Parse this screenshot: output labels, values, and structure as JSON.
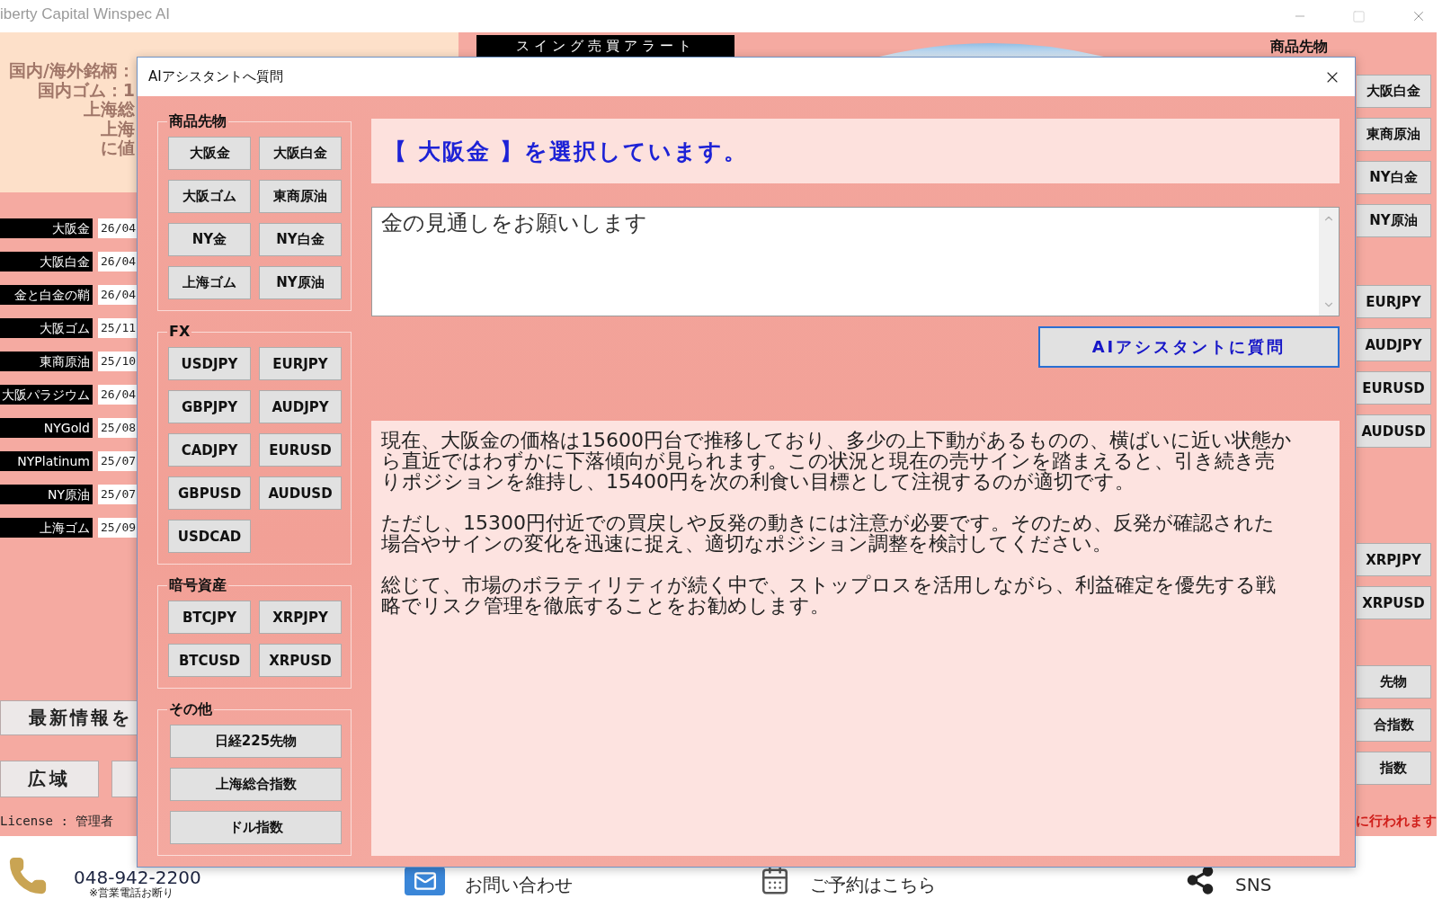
{
  "app_window": {
    "title": "iberty Capital Winspec AI"
  },
  "info_panel": {
    "lines": [
      "国内/海外銘柄：",
      "国内ゴム：1",
      "上海総",
      "上海",
      "に値"
    ]
  },
  "alert_header": {
    "label": "スイング売買アラート"
  },
  "signal_list": [
    {
      "name": "大阪金",
      "date": "26/04"
    },
    {
      "name": "大阪白金",
      "date": "26/04"
    },
    {
      "name": "金と白金の鞘",
      "date": "26/04"
    },
    {
      "name": "大阪ゴム",
      "date": "25/11"
    },
    {
      "name": "東商原油",
      "date": "25/10"
    },
    {
      "name": "大阪パラジウム",
      "date": "26/04"
    },
    {
      "name": "NYGold",
      "date": "25/08"
    },
    {
      "name": "NYPlatinum",
      "date": "25/07"
    },
    {
      "name": "NY原油",
      "date": "25/07"
    },
    {
      "name": "上海ゴム",
      "date": "25/09"
    }
  ],
  "left_buttons": {
    "news": "最新情報を",
    "area": "広域"
  },
  "license": "License : 管理者",
  "right_panel": {
    "heading": "商品先物",
    "groups": [
      [
        "大阪白金",
        "東商原油",
        "NY白金",
        "NY原油"
      ],
      [
        "EURJPY",
        "AUDJPY",
        "EURUSD",
        "AUDUSD"
      ],
      [
        "XRPJPY",
        "XRPUSD"
      ],
      [
        "先物",
        "合指数",
        "指数"
      ]
    ],
    "notice": "に行われます"
  },
  "footer": {
    "phone": "048-942-2200",
    "phone_note": "※営業電話お断り",
    "links": [
      {
        "kind": "contact",
        "label": "お問い合わせ"
      },
      {
        "kind": "booking",
        "label": "ご予約はこちら"
      },
      {
        "kind": "sns",
        "label": "SNS"
      }
    ]
  },
  "dialog": {
    "title": "AIアシスタントへ質問",
    "groups": [
      {
        "label": "商品先物",
        "kind": "pair",
        "buttons": [
          "大阪金",
          "大阪白金",
          "大阪ゴム",
          "東商原油",
          "NY金",
          "NY白金",
          "上海ゴム",
          "NY原油"
        ]
      },
      {
        "label": "FX",
        "kind": "pair",
        "buttons": [
          "USDJPY",
          "EURJPY",
          "GBPJPY",
          "AUDJPY",
          "CADJPY",
          "EURUSD",
          "GBPUSD",
          "AUDUSD",
          "USDCAD"
        ]
      },
      {
        "label": "暗号資産",
        "kind": "pair",
        "buttons": [
          "BTCJPY",
          "XRPJPY",
          "BTCUSD",
          "XRPUSD"
        ]
      },
      {
        "label": "その他",
        "kind": "single",
        "buttons": [
          "日経225先物",
          "上海総合指数",
          "ドル指数"
        ]
      }
    ],
    "selection": "【 大阪金 】を選択しています。",
    "question": {
      "value": "金の見通しをお願いします"
    },
    "ask_button": "AIアシスタントに質問",
    "answer": [
      "現在、大阪金の価格は15600円台で推移しており、多少の上下動があるものの、横ばいに近い状態から直近ではわずかに下落傾向が見られます。この状況と現在の売サインを踏まえると、引き続き売りポジションを維持し、15400円を次の利食い目標として注視するのが適切です。",
      "ただし、15300円付近での買戻しや反発の動きには注意が必要です。そのため、反発が確認された場合やサインの変化を迅速に捉え、適切なポジション調整を検討してください。",
      "総じて、市場のボラティリティが続く中で、ストップロスを活用しながら、利益確定を優先する戦略でリスク管理を徹底することをお勧めします。"
    ]
  }
}
